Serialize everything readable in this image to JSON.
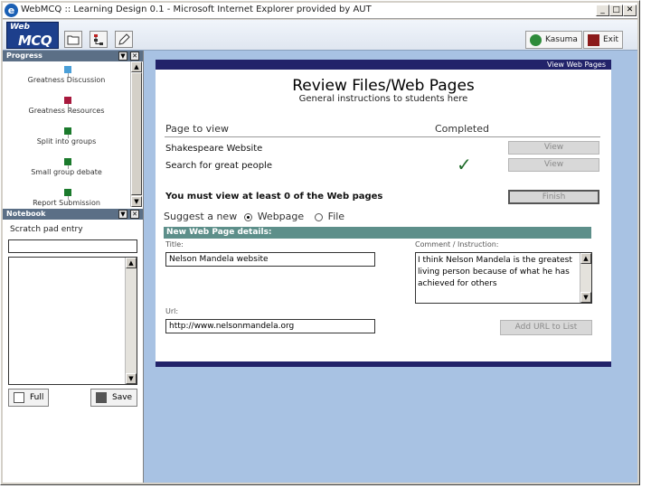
{
  "window": {
    "title": "WebMCQ :: Learning Design 0.1 - Microsoft Internet Explorer provided by AUT"
  },
  "toolbar": {
    "logo_web": "Web",
    "logo_mcq": "MCQ",
    "user_label": "Kasuma",
    "exit_label": "Exit"
  },
  "progress": {
    "header": "Progress",
    "steps": [
      {
        "label": "Greatness Discussion",
        "color": "#4a9fd8"
      },
      {
        "label": "Greatness Resources",
        "color": "#a8193d"
      },
      {
        "label": "Split into groups",
        "color": "#1b7a2c"
      },
      {
        "label": "Small group debate",
        "color": "#1b7a2c"
      },
      {
        "label": "Report Submission",
        "color": "#1b7a2c"
      }
    ]
  },
  "notebook": {
    "header": "Notebook",
    "scratch_label": "Scratch pad entry",
    "full_label": "Full",
    "save_label": "Save"
  },
  "review": {
    "view_web_pages": "View Web Pages",
    "title": "Review Files/Web Pages",
    "subtitle": "General instructions to students here",
    "col_page": "Page to view",
    "col_completed": "Completed",
    "rows": [
      {
        "label": "Shakespeare Website",
        "button": "View",
        "completed": false
      },
      {
        "label": "Search for great people",
        "button": "View",
        "completed": true
      }
    ],
    "check_glyph": "✓",
    "must_view": "You must view at least 0 of the Web pages",
    "finish_label": "Finish",
    "suggest_label": "Suggest a new",
    "opt_webpage": "Webpage",
    "opt_file": "File",
    "details_header": "New Web Page details:",
    "title_label": "Title:",
    "title_value": "Nelson Mandela website",
    "comment_label": "Comment / Instruction:",
    "comment_value": "I think Nelson Mandela is the greatest living person because of what he has achieved for others",
    "url_label": "Url:",
    "url_value": "http://www.nelsonmandela.org",
    "add_url_label": "Add URL to List"
  }
}
